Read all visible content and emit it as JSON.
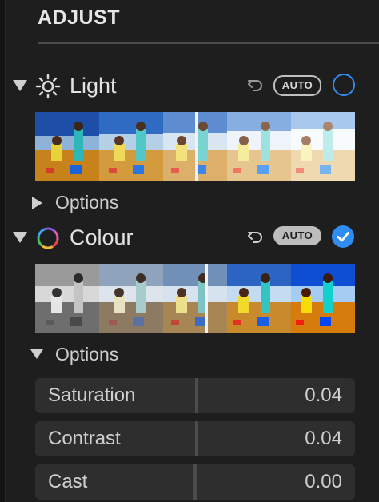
{
  "header": {
    "title": "ADJUST"
  },
  "light": {
    "label": "Light",
    "auto_label": "AUTO",
    "options_label": "Options",
    "icon": "sun-icon",
    "checked": false
  },
  "colour": {
    "label": "Colour",
    "auto_label": "AUTO",
    "options_label": "Options",
    "icon": "colour-wheel-icon",
    "checked": true
  },
  "sliders": [
    {
      "label": "Saturation",
      "value": "0.04"
    },
    {
      "label": "Contrast",
      "value": "0.04"
    },
    {
      "label": "Cast",
      "value": "0.00"
    }
  ],
  "colors": {
    "accent": "#2f8cf0",
    "panel": "#1e1e1e",
    "row": "#2e2e2e"
  }
}
